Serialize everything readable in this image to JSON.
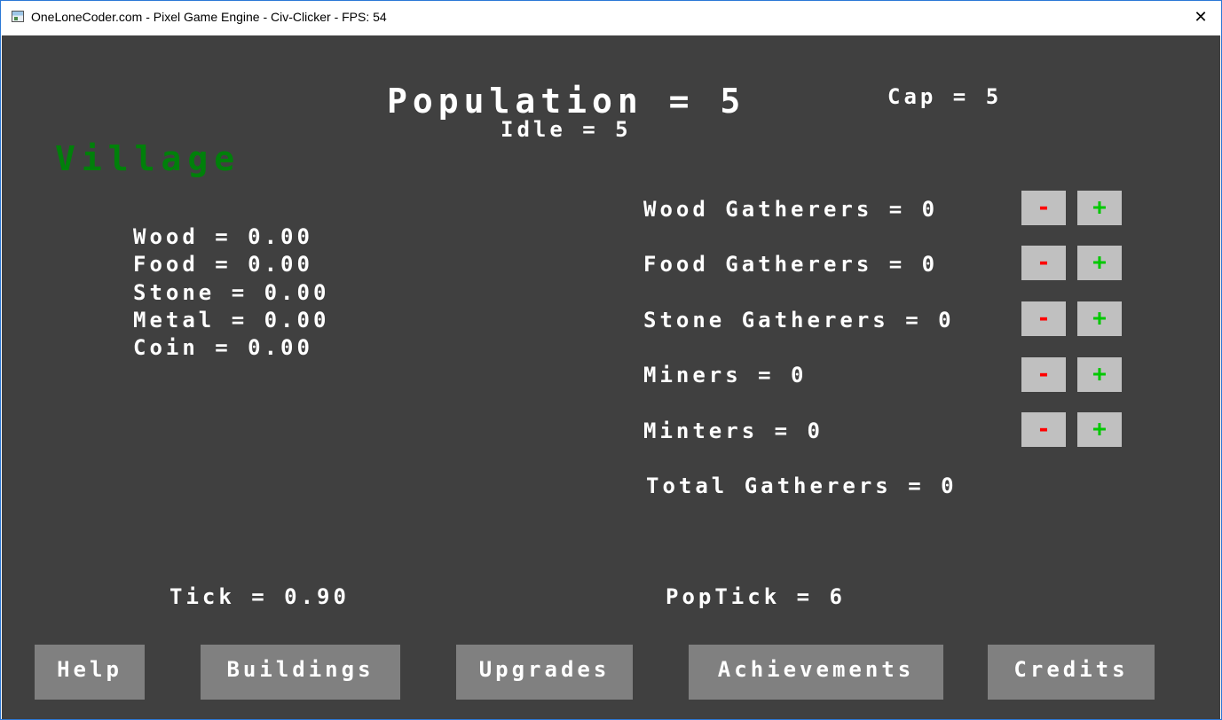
{
  "window": {
    "title": "OneLoneCoder.com - Pixel Game Engine - Civ-Clicker - FPS: 54",
    "close_glyph": "✕"
  },
  "header": {
    "population": "Population = 5",
    "cap": "Cap = 5",
    "idle": "Idle = 5",
    "section_title": "Village"
  },
  "resources": [
    "Wood = 0.00",
    "Food = 0.00",
    "Stone = 0.00",
    "Metal = 0.00",
    "Coin = 0.00"
  ],
  "workers": [
    {
      "label": "Wood Gatherers = 0",
      "minus": "-",
      "plus": "+"
    },
    {
      "label": "Food Gatherers = 0",
      "minus": "-",
      "plus": "+"
    },
    {
      "label": "Stone Gatherers = 0",
      "minus": "-",
      "plus": "+"
    },
    {
      "label": "Miners = 0",
      "minus": "-",
      "plus": "+"
    },
    {
      "label": "Minters = 0",
      "minus": "-",
      "plus": "+"
    }
  ],
  "total_gatherers": "Total Gatherers = 0",
  "tick": "Tick = 0.90",
  "pop_tick": "PopTick = 6",
  "nav": {
    "help": "Help",
    "buildings": "Buildings",
    "upgrades": "Upgrades",
    "achievements": "Achievements",
    "credits": "Credits"
  },
  "colors": {
    "background": "#404040",
    "village_title": "#00800a",
    "minus": "#ff0000",
    "plus": "#00c800",
    "worker_button": "#c0c0c0",
    "nav_button": "#808080"
  }
}
